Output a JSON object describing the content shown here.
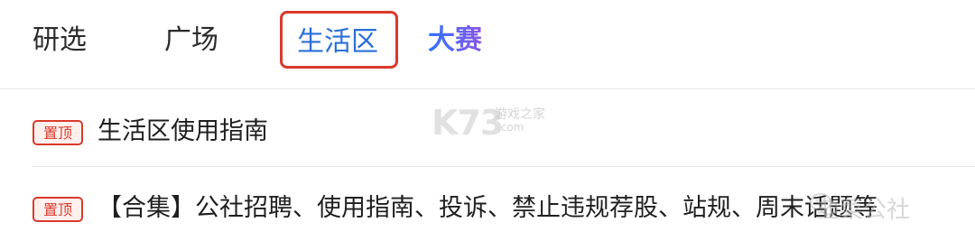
{
  "tabs": [
    {
      "label": "研选",
      "active": false
    },
    {
      "label": "广场",
      "active": false
    },
    {
      "label": "生活区",
      "active": true
    },
    {
      "label": "大赛",
      "active": false
    }
  ],
  "list": [
    {
      "badge": "置顶",
      "title": "生活区使用指南"
    },
    {
      "badge": "置顶",
      "title": "【合集】公社招聘、使用指南、投诉、禁止违规荐股、站规、周末话题等"
    }
  ],
  "watermarks": {
    "k73_logo": "K73",
    "k73_site": "游戏之家",
    "k73_site_sub": ".com",
    "account": "韭菜公社"
  },
  "colors": {
    "active_tab": "#2b6fd8",
    "highlight_box": "#d93a2b",
    "badge": "#d93a2b",
    "gradient_start": "#2f73ff",
    "gradient_end": "#8b55e6"
  }
}
